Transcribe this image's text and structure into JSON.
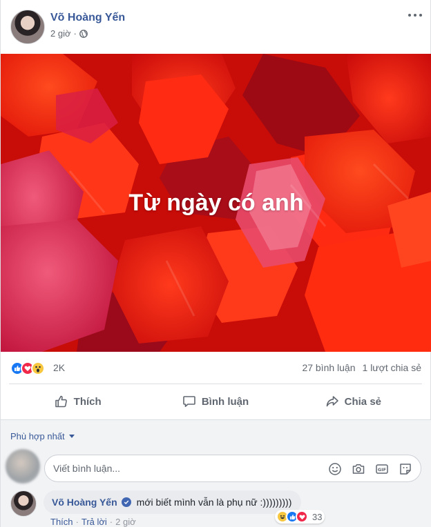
{
  "post": {
    "author": "Võ Hoàng Yến",
    "time": "2 giờ",
    "privacy_icon": "globe-icon",
    "menu_icon": "more-options-icon",
    "status_text": "Từ ngày có anh",
    "background_colors": [
      "#d10f08",
      "#ff2a14",
      "#a80a2f",
      "#e8456a"
    ]
  },
  "stats": {
    "reactions": [
      "like-icon",
      "love-icon",
      "wow-icon"
    ],
    "reaction_count": "2K",
    "comments": "27 bình luận",
    "shares": "1 lượt chia sẻ"
  },
  "actions": {
    "like": "Thích",
    "comment": "Bình luận",
    "share": "Chia sẻ"
  },
  "comments_section": {
    "sort_label": "Phù hợp nhất",
    "composer_placeholder": "Viết bình luận...",
    "composer_tools": [
      "emoji-icon",
      "camera-icon",
      "gif-icon",
      "sticker-icon"
    ],
    "comment": {
      "author": "Võ Hoàng Yến",
      "verified": true,
      "text": "mới biết mình vẫn là phụ nữ :)))))))))",
      "reactions": [
        "haha-icon",
        "like-icon",
        "love-icon"
      ],
      "reaction_count": "33",
      "like_link": "Thích",
      "reply_link": "Trả lời",
      "time": "2 giờ"
    }
  },
  "colors": {
    "link_blue": "#385898",
    "like_blue": "#1877f2",
    "love_red": "#f0284a",
    "wow_yellow": "#f7c740"
  }
}
